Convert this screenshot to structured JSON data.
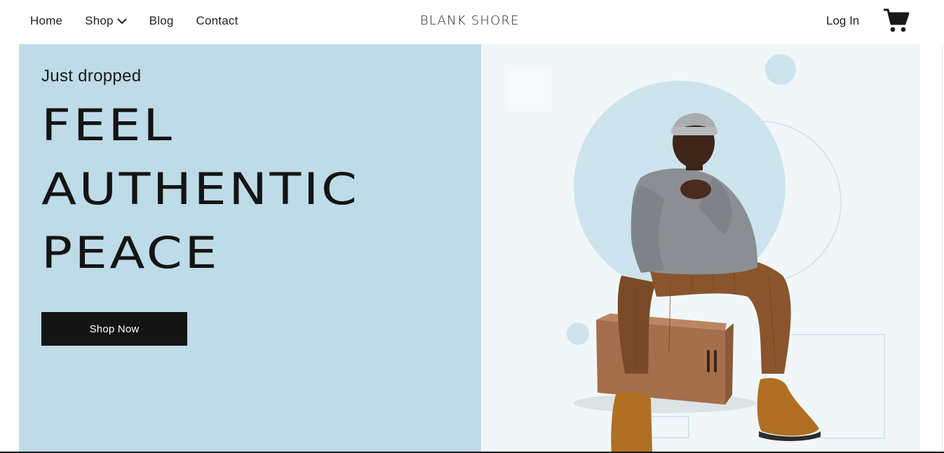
{
  "header": {
    "nav": [
      {
        "label": "Home"
      },
      {
        "label": "Shop",
        "has_dropdown": true
      },
      {
        "label": "Blog"
      },
      {
        "label": "Contact"
      }
    ],
    "brand": "Blank Shore",
    "login_label": "Log In",
    "cart_icon": "shopping-cart-icon"
  },
  "hero": {
    "kicker": "Just dropped",
    "headline": [
      "Feel",
      "Authentic",
      "Peace"
    ],
    "cta_label": "Shop Now",
    "image_alt": "Man in grey sweater and beanie sitting on wooden box"
  },
  "colors": {
    "hero_left_bg": "#bedbe8",
    "hero_right_bg": "#f1f7f9",
    "accent_circle": "#cde4ee",
    "button_bg": "#141414",
    "button_text": "#ffffff"
  }
}
